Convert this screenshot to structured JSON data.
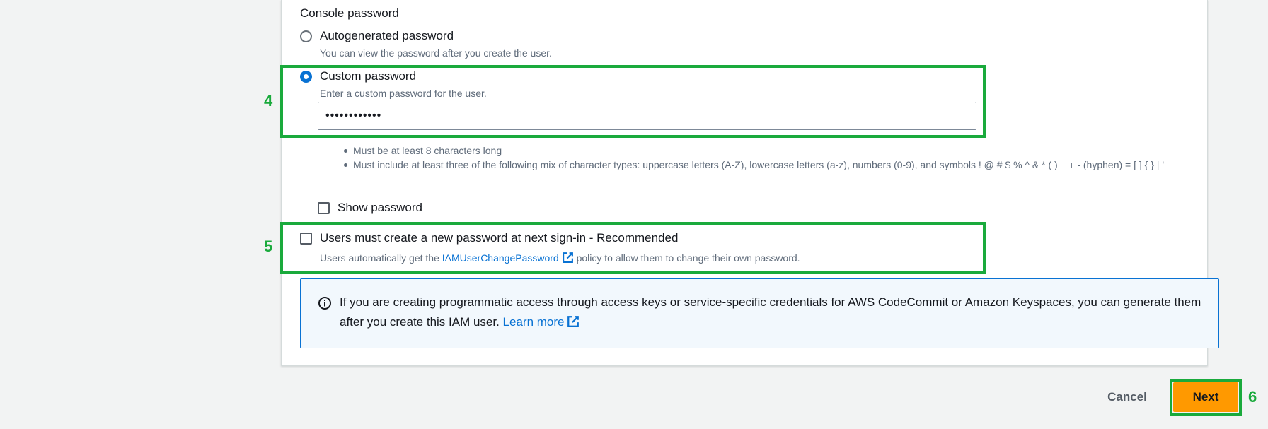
{
  "section": {
    "label": "Console password"
  },
  "options": {
    "autogenerated": {
      "title": "Autogenerated password",
      "desc": "You can view the password after you create the user.",
      "checked": false
    },
    "custom": {
      "title": "Custom password",
      "desc": "Enter a custom password for the user.",
      "value": "••••••••••••",
      "checked": true
    }
  },
  "rules": [
    "Must be at least 8 characters long",
    "Must include at least three of the following mix of character types: uppercase letters (A-Z), lowercase letters (a-z), numbers (0-9), and symbols ! @ # $ % ^ & * ( ) _ + - (hyphen) = [ ] { } | '"
  ],
  "show_password": {
    "label": "Show password",
    "checked": false
  },
  "reset_required": {
    "label": "Users must create a new password at next sign-in - Recommended",
    "desc_before": "Users automatically get the ",
    "desc_link": "IAMUserChangePassword",
    "desc_after": " policy to allow them to change their own password.",
    "checked": false
  },
  "info": {
    "text": "If you are creating programmatic access through access keys or service-specific credentials for AWS CodeCommit or Amazon Keyspaces, you can generate them after you create this IAM user. ",
    "link": "Learn more"
  },
  "buttons": {
    "cancel": "Cancel",
    "next": "Next"
  },
  "steps": {
    "custom": "4",
    "reset": "5",
    "next": "6"
  },
  "colors": {
    "highlight": "#1aaa3c",
    "primary": "#ff9900",
    "link": "#0972d3"
  }
}
